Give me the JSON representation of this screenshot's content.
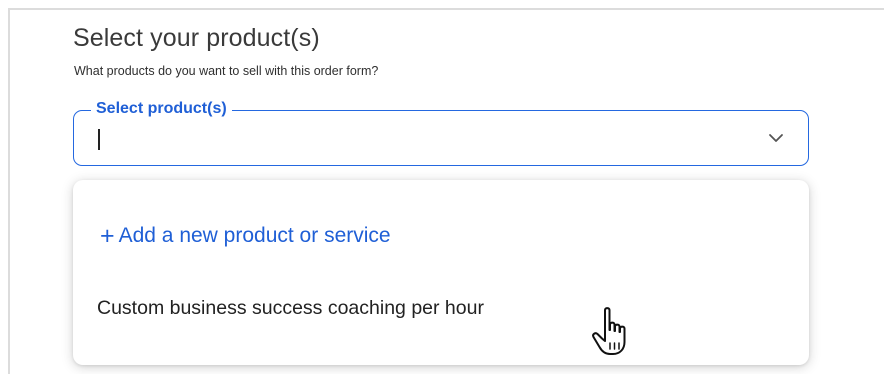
{
  "form": {
    "title": "Select your product(s)",
    "subtitle": "What products do you want to sell with this order form?"
  },
  "select": {
    "label": "Select product(s)",
    "value": "",
    "icon": "chevron-down-icon"
  },
  "dropdown": {
    "add_new_icon": "+",
    "add_new_label": "Add a new product or service",
    "options": [
      {
        "label": "Custom business success coaching per hour"
      }
    ]
  },
  "colors": {
    "accent": "#1f5fd6",
    "border_focus": "#2468e0",
    "text": "#222222"
  }
}
